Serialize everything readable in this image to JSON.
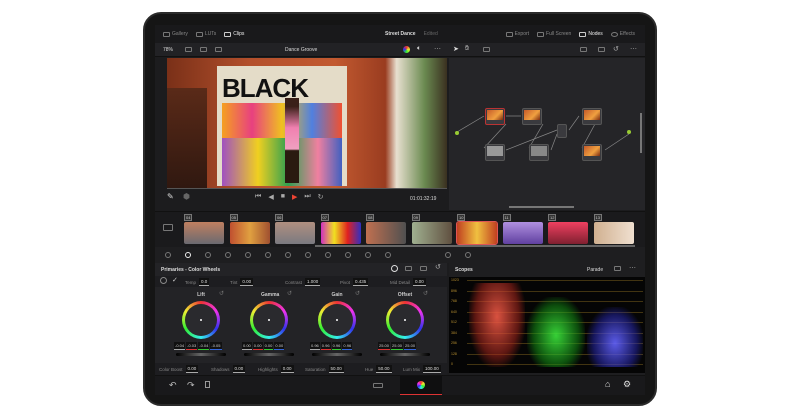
{
  "topbar": {
    "gallery": "Gallery",
    "luts": "LUTs",
    "clips": "Clips",
    "project": "Street Dance",
    "status": "Edited",
    "export": "Export",
    "fullscreen": "Full Screen",
    "nodes": "Nodes",
    "effects": "Effects"
  },
  "toolbar": {
    "zoom": "78%",
    "clip_name": "Dance Groove"
  },
  "viewer": {
    "mural_text": "BLACK",
    "timecode": "01:01:32:19"
  },
  "timeline": {
    "clips": [
      "04",
      "05",
      "06",
      "07",
      "08",
      "09",
      "10",
      "11",
      "12",
      "13"
    ]
  },
  "primaries": {
    "title": "Primaries - Color Wheels",
    "top_params": [
      {
        "label": "Temp",
        "value": "0.0"
      },
      {
        "label": "Tint",
        "value": "0.00"
      },
      {
        "label": "Contrast",
        "value": "1.000"
      },
      {
        "label": "Pivot",
        "value": "0.435"
      },
      {
        "label": "Mid Detail",
        "value": "0.00"
      }
    ],
    "wheels": [
      {
        "label": "Lift",
        "values": [
          "-0.04",
          "-0.03",
          "-0.04",
          "-0.05"
        ]
      },
      {
        "label": "Gamma",
        "values": [
          "0.00",
          "0.00",
          "0.00",
          "0.00"
        ]
      },
      {
        "label": "Gain",
        "values": [
          "0.96",
          "0.96",
          "0.96",
          "0.96"
        ]
      },
      {
        "label": "Offset",
        "values": [
          "25.00",
          "25.00",
          "25.00"
        ]
      }
    ],
    "bottom_params": [
      {
        "label": "Color Boost",
        "value": "0.00"
      },
      {
        "label": "Shadows",
        "value": "0.00"
      },
      {
        "label": "Highlights",
        "value": "0.00"
      },
      {
        "label": "Saturation",
        "value": "50.00"
      },
      {
        "label": "Hue",
        "value": "50.00"
      },
      {
        "label": "Lum Mix",
        "value": "100.00"
      }
    ]
  },
  "scopes": {
    "title": "Scopes",
    "mode": "Parade",
    "scale": [
      "1023",
      "896",
      "768",
      "640",
      "512",
      "384",
      "256",
      "128",
      "0"
    ]
  }
}
